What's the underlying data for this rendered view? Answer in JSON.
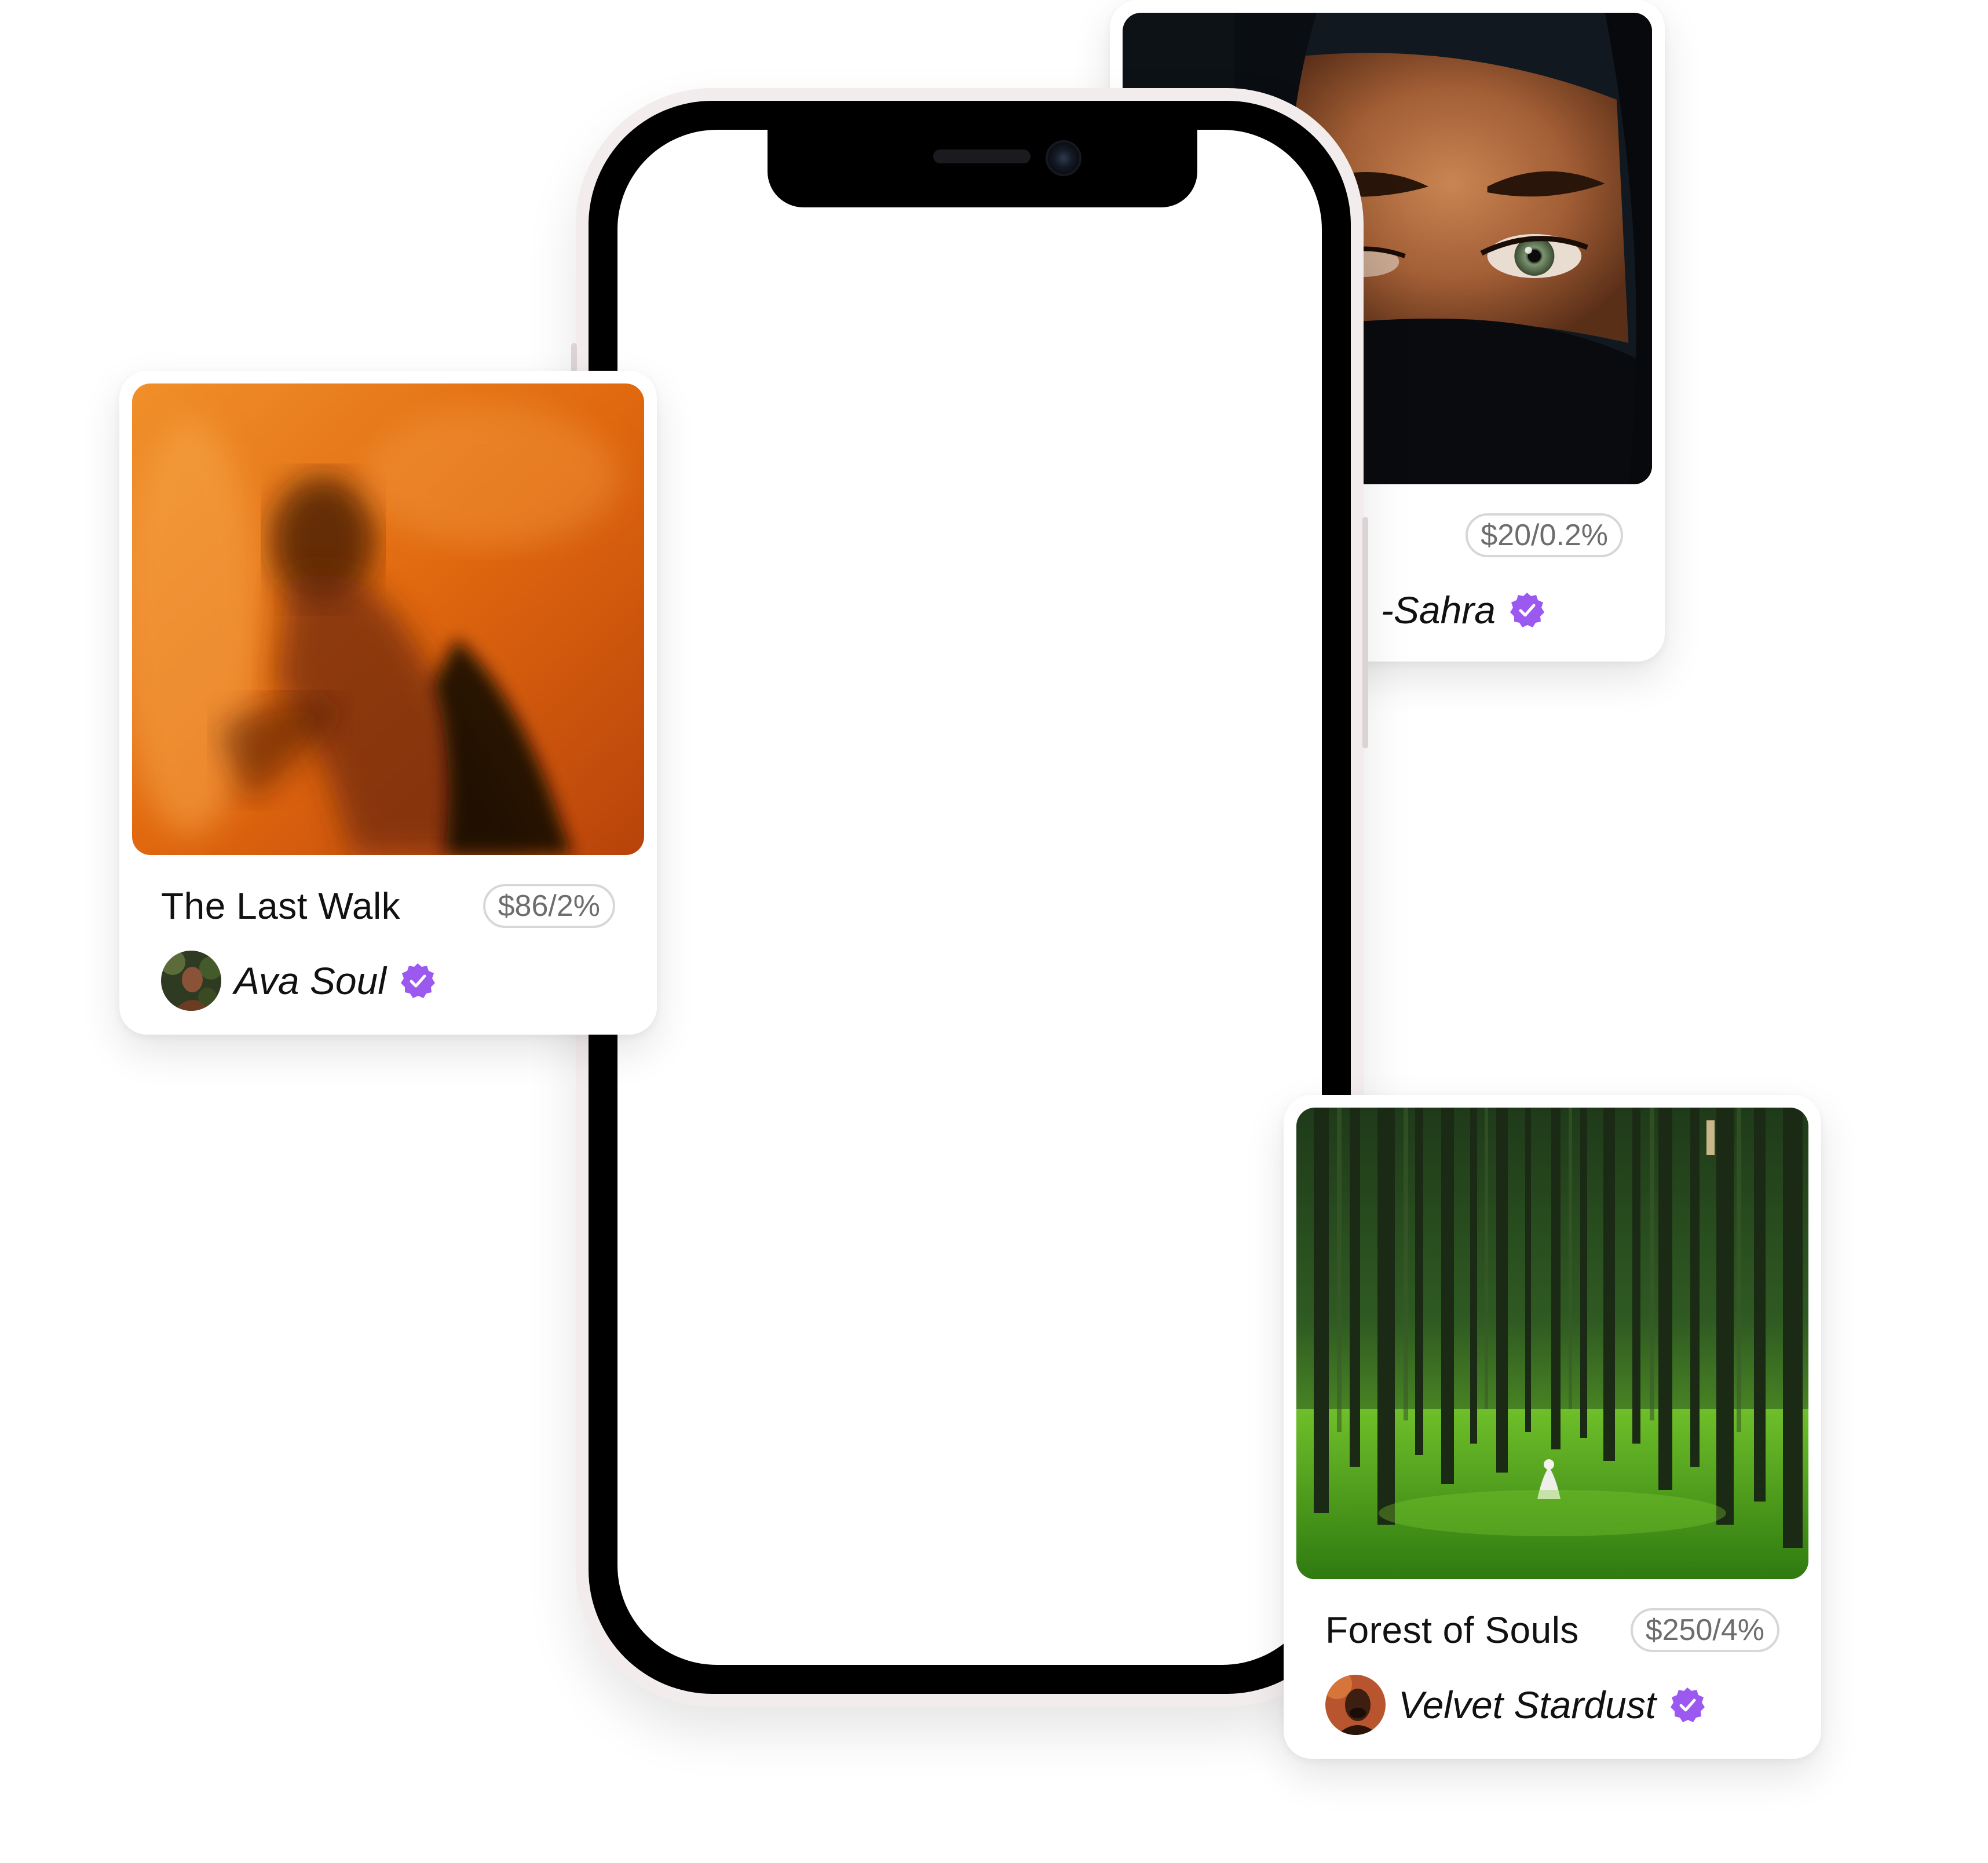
{
  "cards": [
    {
      "id": "eyes",
      "title": "",
      "price": "$20/0.2%",
      "artist": "-Sahra",
      "verified_icon": "verified-badge-icon"
    },
    {
      "id": "ava",
      "title": "The Last Walk",
      "price": "$86/2%",
      "artist": "Ava Soul",
      "verified_icon": "verified-badge-icon"
    },
    {
      "id": "forest",
      "title": "Forest of Souls",
      "price": "$250/4%",
      "artist": "Velvet Stardust",
      "verified_icon": "verified-badge-icon"
    }
  ],
  "colors": {
    "verified_badge": "#9b59f0",
    "phone_frame": "#f3ecec",
    "bezel": "#000000",
    "price_text": "#6d6d6d"
  }
}
